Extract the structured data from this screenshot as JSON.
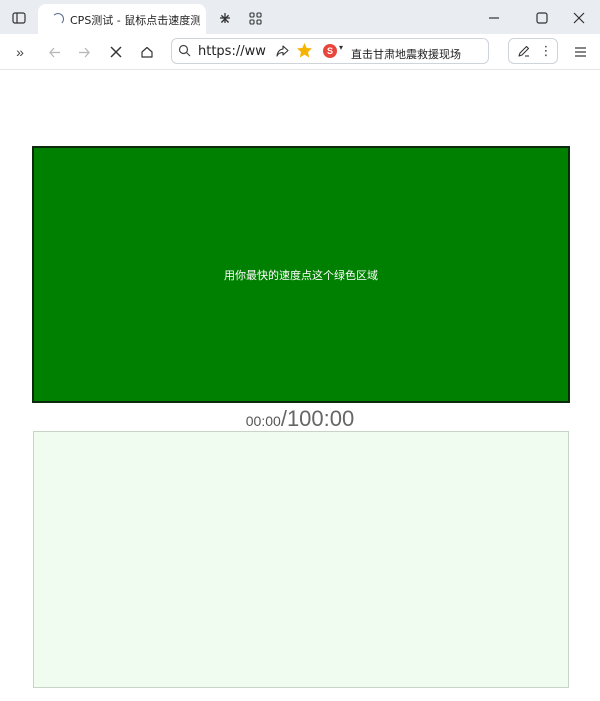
{
  "browser": {
    "tab_title": "CPS测试 - 鼠标点击速度测",
    "url_text": "https://ww",
    "hot_search": "直击甘肃地震救援现场",
    "engine_badge": "S"
  },
  "page": {
    "click_prompt": "用你最快的速度点这个绿色区域",
    "timer_elapsed": "00:00",
    "timer_separator": "/",
    "timer_total": "100:00"
  },
  "colors": {
    "click_area": "#008000",
    "result_area": "#effcef",
    "tab_strip": "#e9ecf1"
  },
  "icons": {
    "sidebar": "sidebar-icon",
    "new_tab": "plus-icon",
    "tab_grid": "grid-icon",
    "minimize": "minimize-icon",
    "maximize": "maximize-icon",
    "close": "close-icon",
    "extensions": "double-chevron-icon",
    "back": "arrow-left-icon",
    "forward": "arrow-right-icon",
    "stop": "stop-x-icon",
    "home": "home-icon",
    "search": "search-icon",
    "share": "share-icon",
    "favorite": "star-icon",
    "reading": "pen-icon",
    "more": "kebab-icon",
    "menu": "hamburger-icon"
  }
}
